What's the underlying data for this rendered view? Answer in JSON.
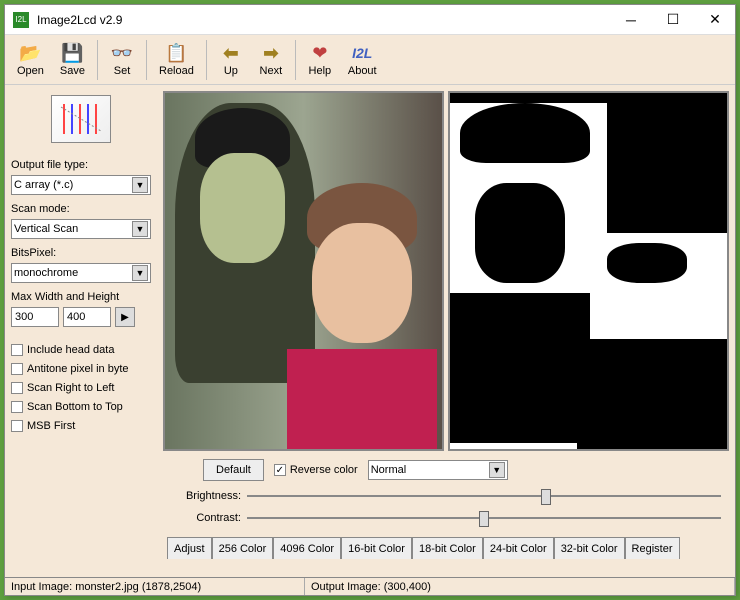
{
  "window": {
    "title": "Image2Lcd v2.9"
  },
  "toolbar": {
    "open": "Open",
    "save": "Save",
    "set": "Set",
    "reload": "Reload",
    "up": "Up",
    "next": "Next",
    "help": "Help",
    "about": "About",
    "about_icon": "I2L"
  },
  "sidebar": {
    "output_type_label": "Output file type:",
    "output_type_value": "C array (*.c)",
    "scan_mode_label": "Scan mode:",
    "scan_mode_value": "Vertical Scan",
    "bitspixel_label": "BitsPixel:",
    "bitspixel_value": "monochrome",
    "maxwh_label": "Max Width and Height",
    "max_width": "300",
    "max_height": "400",
    "checks": {
      "include_head": "Include head data",
      "antitone": "Antitone pixel in byte",
      "scan_rtl": "Scan Right to Left",
      "scan_btt": "Scan Bottom to Top",
      "msb_first": "MSB First"
    }
  },
  "controls": {
    "default_btn": "Default",
    "reverse_label": "Reverse color",
    "mode_value": "Normal",
    "brightness_label": "Brightness:",
    "contrast_label": "Contrast:",
    "reverse_checked": true
  },
  "tabs": {
    "adjust": "Adjust",
    "c256": "256 Color",
    "c4096": "4096 Color",
    "c16": "16-bit Color",
    "c18": "18-bit Color",
    "c24": "24-bit Color",
    "c32": "32-bit Color",
    "register": "Register"
  },
  "status": {
    "input_label": "Input Image: monster2.jpg (1878,2504)",
    "output_label": "Output Image: (300,400)"
  }
}
